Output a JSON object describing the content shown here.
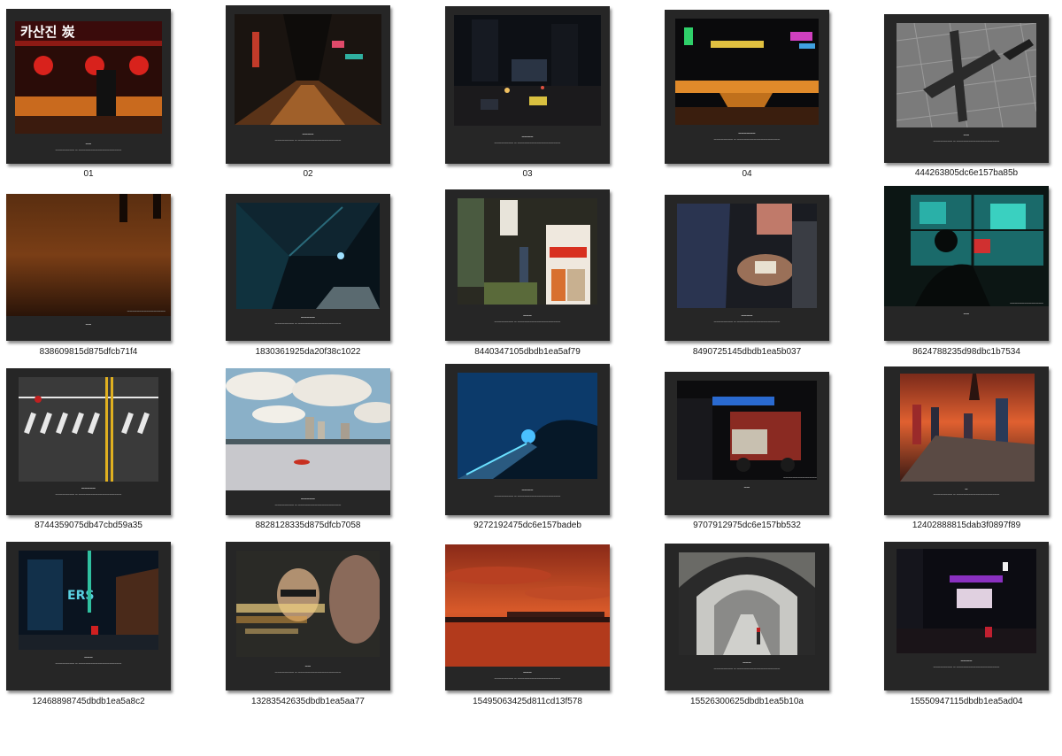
{
  "files": [
    {
      "name": "01",
      "photo": "red-lantern-food-stall",
      "caption": "ЖЖЖ"
    },
    {
      "name": "02",
      "photo": "night-alley-street"
    },
    {
      "name": "03",
      "photo": "city-intersection-night"
    },
    {
      "name": "04",
      "photo": "neon-bridge-night"
    },
    {
      "name": "444263805dc6e157ba85b",
      "photo": "shadow-cross-pavement"
    },
    {
      "name": "838609815d875dfcb71f4",
      "photo": "orange-sunset-silhouettes"
    },
    {
      "name": "1830361925da20f38c1022",
      "photo": "dark-underpass"
    },
    {
      "name": "8440347105dbdb1ea5af79",
      "photo": "korean-signs-alley"
    },
    {
      "name": "8490725145dbdb1ea5b037",
      "photo": "street-game-table"
    },
    {
      "name": "8624788235d98dbc1b7534",
      "photo": "silhouette-window-rain"
    },
    {
      "name": "8744359075db47cbd59a35",
      "photo": "crosswalk-aerial"
    },
    {
      "name": "8828128335d875dfcb7058",
      "photo": "river-city-clouds"
    },
    {
      "name": "9272192475dc6e157badeb",
      "photo": "blue-tunnel-stairs"
    },
    {
      "name": "9707912975dc6e157bb532",
      "photo": "night-truck-street"
    },
    {
      "name": "12402888815dab3f0897f89",
      "photo": "sunset-observation-deck"
    },
    {
      "name": "12468898745dbdb1ea5a8c2",
      "photo": "neon-alley-ers"
    },
    {
      "name": "13283542635dbdb1ea5aa77",
      "photo": "mural-faces-motion"
    },
    {
      "name": "15495063425d811cd13f578",
      "photo": "red-sky-bridge"
    },
    {
      "name": "15526300625dbdb1ea5b10a",
      "photo": "walkway-tunnel-arches"
    },
    {
      "name": "15550947115dbdb1ea5ad04",
      "photo": "purple-neon-street"
    }
  ],
  "colors": {
    "frame": "#262626",
    "background": "#ffffff"
  }
}
